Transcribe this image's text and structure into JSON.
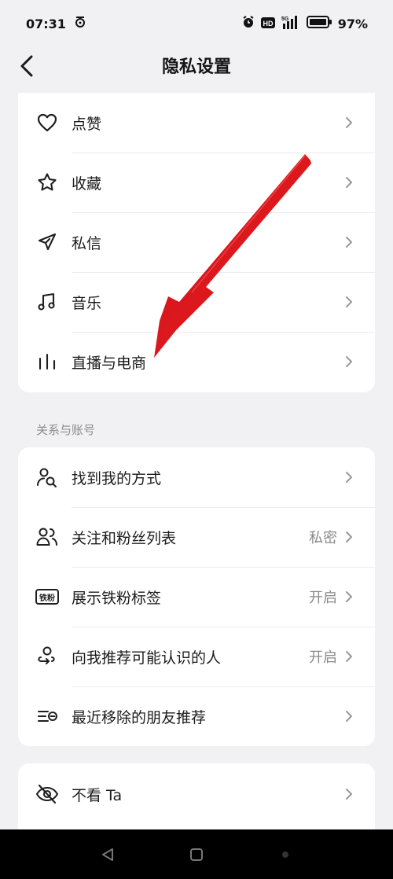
{
  "status_bar": {
    "time": "07:31",
    "battery": "97%"
  },
  "header": {
    "title": "隐私设置"
  },
  "interactions_group": {
    "items": [
      {
        "label": "点赞",
        "icon": "heart-icon"
      },
      {
        "label": "收藏",
        "icon": "star-icon"
      },
      {
        "label": "私信",
        "icon": "send-icon"
      },
      {
        "label": "音乐",
        "icon": "music-note-icon"
      },
      {
        "label": "直播与电商",
        "icon": "bars-icon"
      }
    ]
  },
  "relations_group": {
    "title": "关系与账号",
    "items": [
      {
        "label": "找到我的方式",
        "value": "",
        "icon": "person-search-icon"
      },
      {
        "label": "关注和粉丝列表",
        "value": "私密",
        "icon": "people-icon"
      },
      {
        "label": "展示铁粉标签",
        "value": "开启",
        "icon": "iron-fan-badge-icon",
        "badge_text": "铁粉"
      },
      {
        "label": "向我推荐可能认识的人",
        "value": "开启",
        "icon": "person-recommend-icon"
      },
      {
        "label": "最近移除的朋友推荐",
        "value": "",
        "icon": "list-removed-icon"
      }
    ]
  },
  "hidden_group": {
    "items": [
      {
        "label": "不看 Ta",
        "icon": "eye-off-icon"
      }
    ]
  },
  "annotation": {
    "arrow_color": "#e0191b"
  },
  "colors": {
    "background": "#f1f1f3",
    "card": "#ffffff",
    "secondary_text": "#8a8a8a"
  }
}
